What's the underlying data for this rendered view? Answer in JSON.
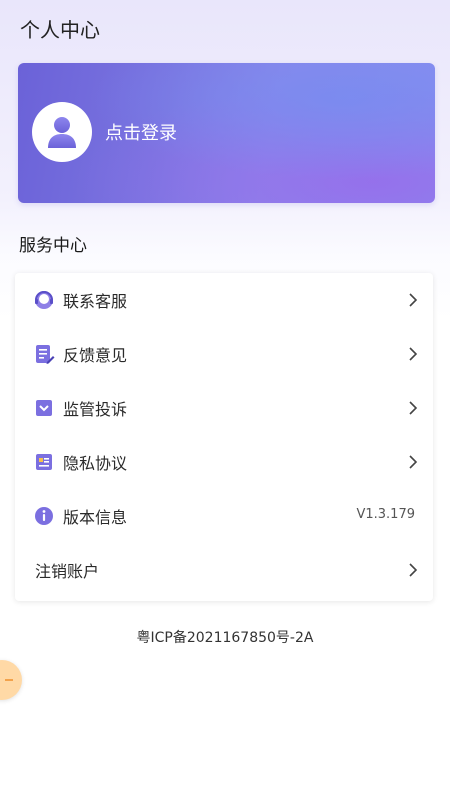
{
  "header": {
    "title": "个人中心"
  },
  "login": {
    "text": "点击登录",
    "avatar_icon": "user-silhouette-icon"
  },
  "services": {
    "title": "服务中心",
    "items": [
      {
        "label": "联系客服",
        "icon": "headset-icon"
      },
      {
        "label": "反馈意见",
        "icon": "edit-note-icon"
      },
      {
        "label": "监管投诉",
        "icon": "complaint-box-icon"
      },
      {
        "label": "隐私协议",
        "icon": "id-card-icon"
      },
      {
        "label": "版本信息",
        "icon": "info-icon",
        "value": "V1.3.179"
      },
      {
        "label": "注销账户"
      }
    ]
  },
  "footer": {
    "icp": "粤ICP备2021167850号-2A"
  },
  "colors": {
    "accent": "#6b62d8",
    "accent_light": "#8a8ef0",
    "float_button": "#ffd9a6"
  }
}
